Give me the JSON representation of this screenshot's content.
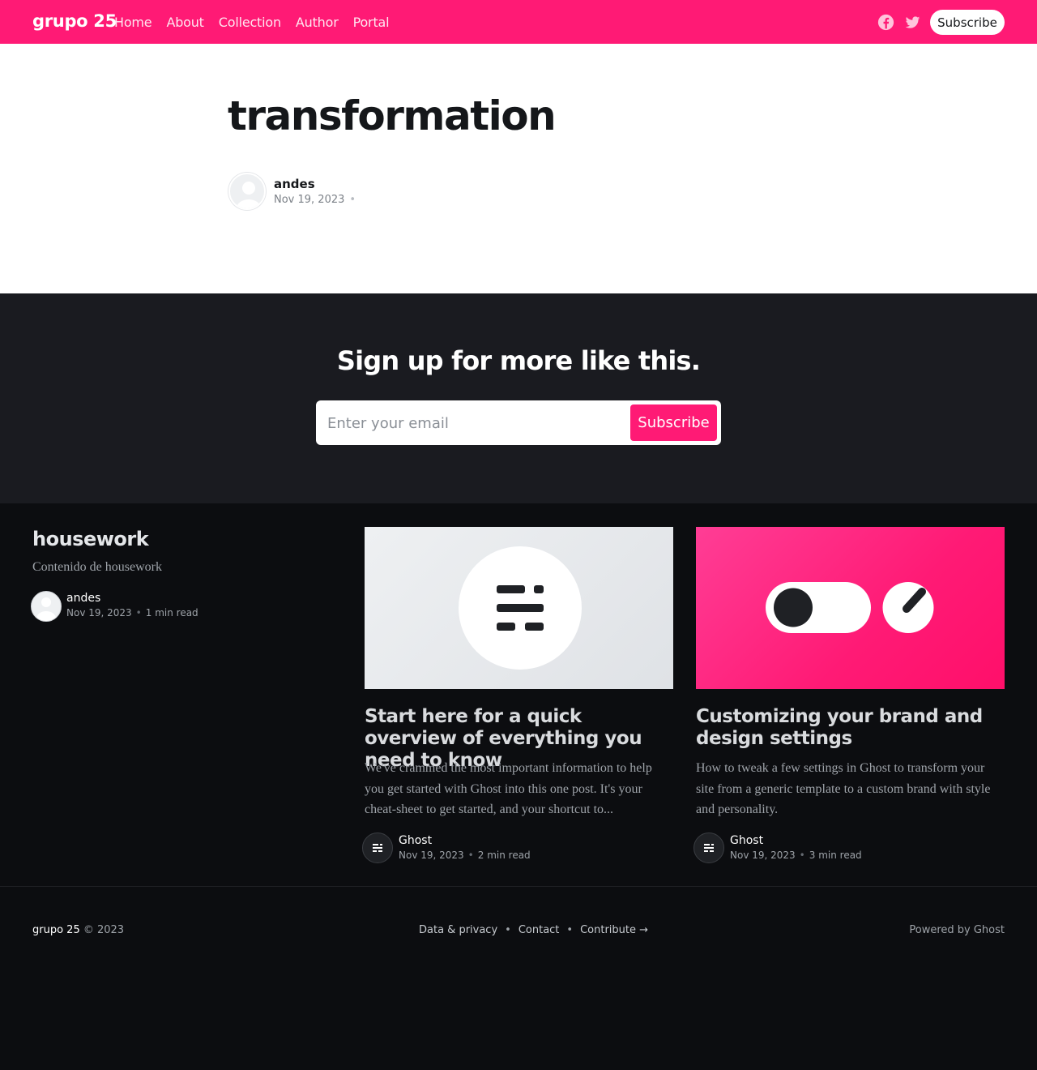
{
  "header": {
    "brand": "grupo 25",
    "nav": [
      "Home",
      "About",
      "Collection",
      "Author",
      "Portal"
    ],
    "subscribe_label": "Subscribe",
    "icons": [
      "facebook-icon",
      "twitter-icon"
    ],
    "accent_color": "#ff1a75"
  },
  "article": {
    "title": "transformation",
    "author": "andes",
    "date": "Nov 19, 2023",
    "separator": "•"
  },
  "signup": {
    "title": "Sign up for more like this.",
    "placeholder": "Enter your email",
    "button_label": "Subscribe"
  },
  "feed": {
    "tag_title": "housework",
    "tag_description": "Contenido de housework",
    "tag_author": "andes",
    "tag_date": "Nov 19, 2023",
    "tag_read_time": "1 min read",
    "cards": [
      {
        "title": "Start here for a quick overview of everything you need to know",
        "excerpt": "We've crammed the most important information to help you get started with Ghost into this one post. It's your cheat-sheet to get started, and your shortcut to...",
        "author": "Ghost",
        "date": "Nov 19, 2023",
        "read_time": "2 min read"
      },
      {
        "title": "Customizing your brand and design settings",
        "excerpt": "How to tweak a few settings in Ghost to transform your site from a generic template to a custom brand with style and personality.",
        "author": "Ghost",
        "date": "Nov 19, 2023",
        "read_time": "3 min read"
      }
    ]
  },
  "footer": {
    "brand": "grupo 25",
    "copyright": "© 2023",
    "links": [
      "Data & privacy",
      "Contact",
      "Contribute →"
    ],
    "separator": "•",
    "powered": "Powered by Ghost"
  }
}
